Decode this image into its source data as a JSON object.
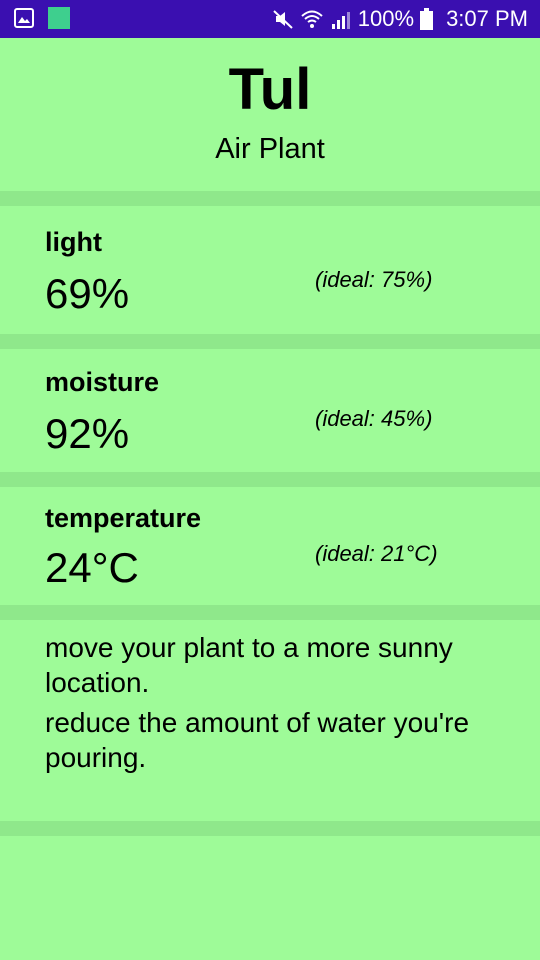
{
  "status_bar": {
    "battery": "100%",
    "time": "3:07 PM",
    "icons": [
      "gallery-icon",
      "app-icon",
      "mute-icon",
      "wifi-icon",
      "signal-icon",
      "battery-icon"
    ]
  },
  "plant": {
    "name": "Tul",
    "type": "Air Plant"
  },
  "metrics": [
    {
      "label": "light",
      "value": "69%",
      "ideal": "(ideal: 75%)"
    },
    {
      "label": "moisture",
      "value": "92%",
      "ideal": "(ideal: 45%)"
    },
    {
      "label": "temperature",
      "value": "24°C",
      "ideal": "(ideal: 21°C)"
    }
  ],
  "advice": [
    "move your plant to a more sunny location.",
    "reduce the amount of water you're pouring."
  ],
  "colors": {
    "background": "#9efb98",
    "divider": "#8fe88b",
    "status_bar": "#3a0fb0"
  }
}
